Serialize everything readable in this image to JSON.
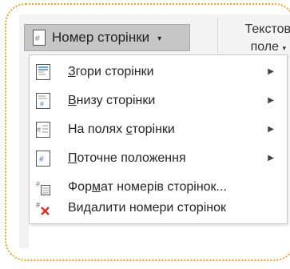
{
  "ribbon": {
    "page_number_button": "Номер сторінки",
    "text_field_line1": "Текстов",
    "text_field_line2": "поле"
  },
  "menu": {
    "items": [
      {
        "pre": "",
        "u": "З",
        "post": "гори сторінки",
        "icon": "page-top-icon",
        "submenu": true
      },
      {
        "pre": "",
        "u": "В",
        "post": "низу сторінки",
        "icon": "page-bottom-icon",
        "submenu": true
      },
      {
        "pre": "На полях ",
        "u": "с",
        "post": "торінки",
        "icon": "page-margins-icon",
        "submenu": true
      },
      {
        "pre": "",
        "u": "П",
        "post": "оточне положення",
        "icon": "current-position-icon",
        "submenu": true
      },
      {
        "pre": "Фор",
        "u": "м",
        "post": "ат номерів сторінок...",
        "icon": "format-page-numbers-icon",
        "submenu": false
      },
      {
        "pre": "Ви",
        "u": "д",
        "post": "алити номери сторінок",
        "icon": "remove-page-numbers-icon",
        "submenu": false
      }
    ]
  },
  "colors": {
    "frame": "#e6a82e",
    "button_bg": "#c6c6c6",
    "delete_red": "#d9302c",
    "icon_blue": "#4a7ebb"
  }
}
